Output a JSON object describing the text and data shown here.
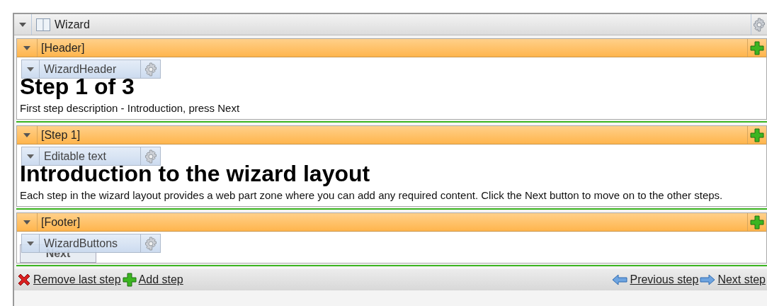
{
  "window": {
    "title": "Wizard"
  },
  "zones": [
    {
      "title": "[Header]",
      "webpart": {
        "title": "WizardHeader"
      },
      "content": {
        "kind": "text",
        "heading": "Step 1 of 3",
        "text": "First step description - Introduction, press Next"
      }
    },
    {
      "title": "[Step 1]",
      "webpart": {
        "title": "Editable text"
      },
      "content": {
        "kind": "text",
        "heading": "Introduction to the wizard layout",
        "text": "Each step in the wizard layout provides a web part zone where you can add any required content. Click the Next button to move on to the other steps."
      }
    },
    {
      "title": "[Footer]",
      "webpart": {
        "title": "WizardButtons"
      },
      "content": {
        "kind": "buttons",
        "buttons": [
          "Next"
        ]
      }
    }
  ],
  "actions_left": [
    {
      "kind": "remove",
      "label": "Remove last step"
    },
    {
      "kind": "add",
      "label": "Add step"
    }
  ],
  "actions_right": [
    {
      "kind": "previous",
      "label": "Previous step"
    },
    {
      "kind": "next",
      "label": "Next step"
    }
  ]
}
